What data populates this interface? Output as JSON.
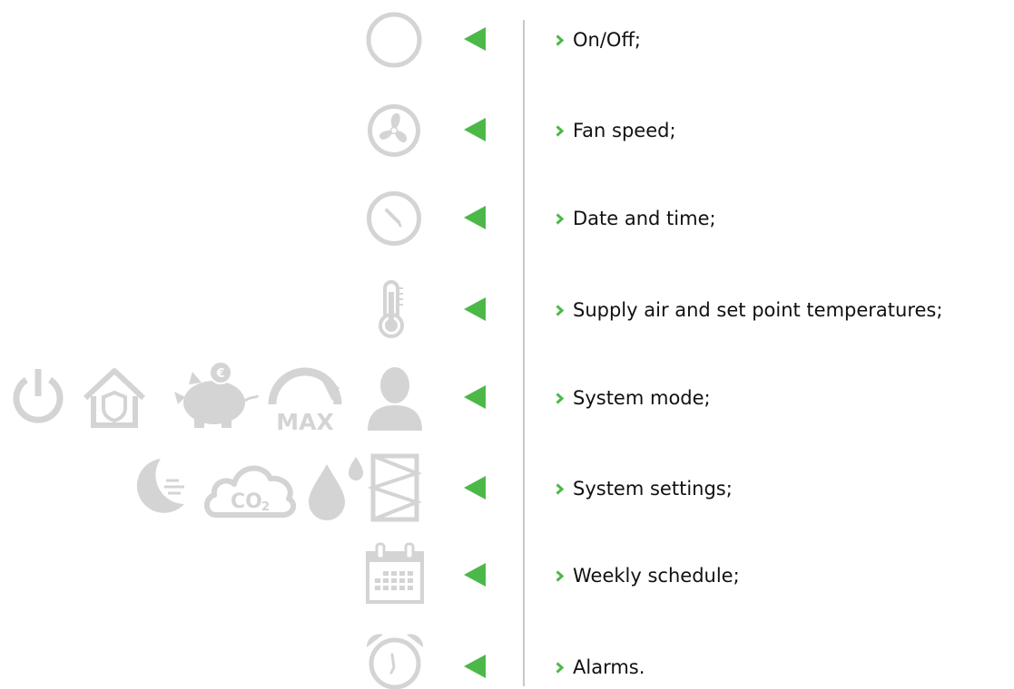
{
  "colors": {
    "accent": "#4cb848",
    "icon_gray": "#d4d4d4",
    "divider": "#c8c8c8",
    "text": "#111111"
  },
  "rows": [
    {
      "label": "On/Off;",
      "icons": [
        "circle-icon"
      ]
    },
    {
      "label": "Fan speed;",
      "icons": [
        "fan-icon"
      ]
    },
    {
      "label": "Date and time;",
      "icons": [
        "clock-icon"
      ]
    },
    {
      "label": "Supply air and set point temperatures;",
      "icons": [
        "thermometer-icon"
      ]
    },
    {
      "label": "System mode;",
      "icons": [
        "power-icon",
        "house-shield-icon",
        "piggy-bank-icon",
        "max-gauge-icon",
        "person-icon"
      ]
    },
    {
      "label": "System settings;",
      "icons": [
        "night-mode-icon",
        "co2-cloud-icon",
        "humidity-drops-icon",
        "filter-icon"
      ]
    },
    {
      "label": "Weekly schedule;",
      "icons": [
        "calendar-icon"
      ]
    },
    {
      "label": "Alarms.",
      "icons": [
        "alarm-clock-icon"
      ]
    }
  ],
  "icon_text": {
    "max": "MAX",
    "co2": "CO",
    "co2_sub": "2",
    "euro": "€"
  }
}
